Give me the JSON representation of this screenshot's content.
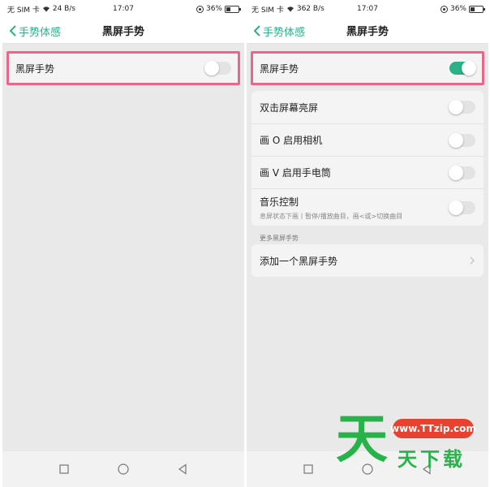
{
  "left": {
    "status": {
      "carrier": "无 SIM 卡",
      "speed": "24 B/s",
      "time": "17:07",
      "battery": "36%"
    },
    "header": {
      "back_label": "手势体感",
      "title": "黑屏手势"
    },
    "rows": [
      {
        "label": "黑屏手势",
        "enabled": false
      }
    ]
  },
  "right": {
    "status": {
      "carrier": "无 SIM 卡",
      "speed": "362 B/s",
      "time": "17:07",
      "battery": "36%"
    },
    "header": {
      "back_label": "手势体感",
      "title": "黑屏手势"
    },
    "main_toggle": {
      "label": "黑屏手势",
      "enabled": true
    },
    "gestures": [
      {
        "label": "双击屏幕亮屏",
        "enabled": false
      },
      {
        "label": "画 O 启用相机",
        "enabled": false
      },
      {
        "label": "画 V 启用手电筒",
        "enabled": false
      },
      {
        "label": "音乐控制",
        "sub": "息屏状态下画丨暂停/播放曲目，画<或>切换曲目",
        "enabled": false
      }
    ],
    "more_section": {
      "title": "更多黑屏手势",
      "add_label": "添加一个黑屏手势"
    }
  },
  "watermark": {
    "big": "天",
    "url": "www.TTzip.com",
    "small": "天下载"
  },
  "colors": {
    "accent": "#2bb088",
    "highlight": "#e8678d",
    "watermark_green": "#27b34a",
    "watermark_red": "#e8412f"
  }
}
